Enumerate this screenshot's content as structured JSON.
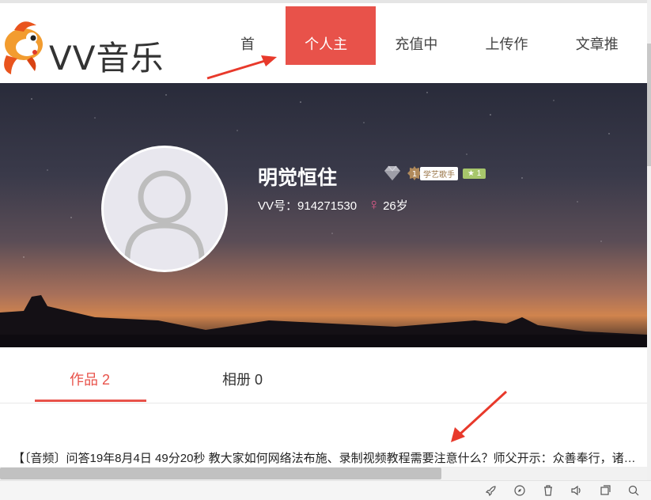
{
  "header": {
    "logo_text": "VV音乐",
    "nav": [
      {
        "label": "首页",
        "active": false
      },
      {
        "label": "个人主页",
        "active": true
      },
      {
        "label": "充值中心",
        "active": false
      },
      {
        "label": "上传作品",
        "active": false
      },
      {
        "label": "文章推荐",
        "active": false
      }
    ]
  },
  "profile": {
    "name": "明觉恒住",
    "name_prefix_glyph": "",
    "name_suffix_glyph": "",
    "level_number": "1",
    "singer_badge": "学艺歌手",
    "star_badge": "★ 1",
    "vv_id": "VV号：914271530",
    "gender_symbol": "♀",
    "age": "26岁"
  },
  "tabs": [
    {
      "label": "作品 2",
      "active": true
    },
    {
      "label": "相册 0",
      "active": false
    }
  ],
  "works": [
    {
      "title": "【〔音频〕问答19年8月4日 49分20秒 教大家如何网络法布施、录制视频教程需要注意什么？师父开示：众善奉行，诸恶莫作"
    }
  ],
  "colors": {
    "accent": "#e8524a",
    "star_badge": "#a7c66b",
    "gender": "#e05a8a"
  },
  "status_icons": [
    "rocket-icon",
    "compass-icon",
    "trash-icon",
    "speaker-icon",
    "window-icon",
    "search-icon"
  ]
}
